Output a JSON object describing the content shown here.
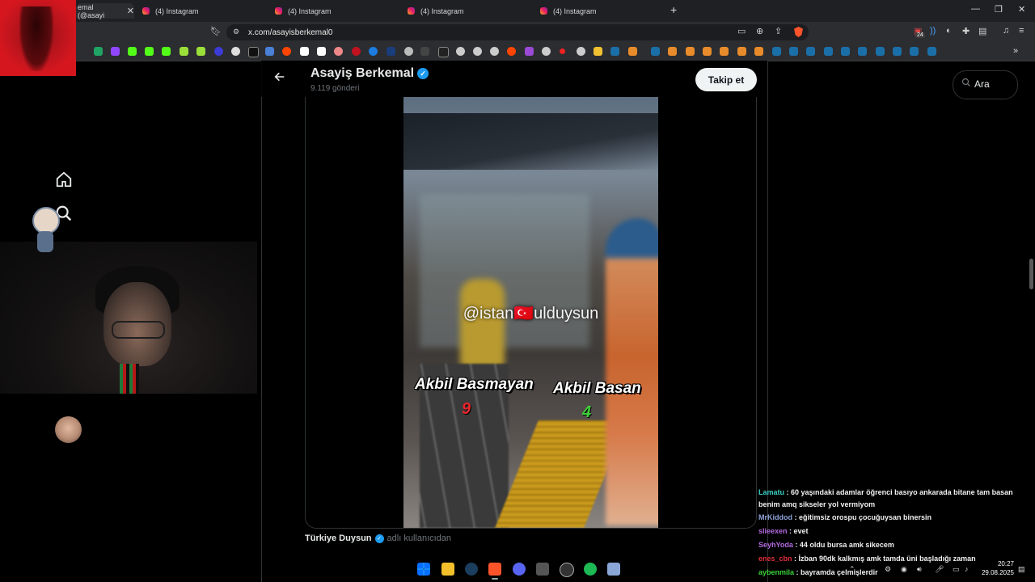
{
  "browser": {
    "tabs": [
      {
        "label": "emal (@asayi",
        "active": true
      },
      {
        "label": "(4) Instagram",
        "active": false
      },
      {
        "label": "(4) Instagram",
        "active": false
      },
      {
        "label": "(4) Instagram",
        "active": false
      },
      {
        "label": "(4) Instagram",
        "active": false
      }
    ],
    "tab_close": "✕",
    "new_tab": "+",
    "window_controls": [
      "—",
      "❐",
      "✕"
    ],
    "url": "x.com/asayisberkemal0",
    "extension_badge": "24",
    "brand_color": "#fb542b"
  },
  "profile": {
    "name": "Asayiş Berkemal",
    "post_count": "9.119 gönderi",
    "follow_label": "Takip et",
    "verified_color": "#1d9bf0"
  },
  "search": {
    "label": "Ara"
  },
  "video": {
    "watermark": "@istan🇹🇷ulduysun",
    "left_label": "Akbil Basmayan",
    "left_count": "9",
    "right_label": "Akbil Basan",
    "right_count": "4"
  },
  "post": {
    "author": "Türkiye Duysun",
    "suffix": "adlı kullanıcıdan"
  },
  "chat": [
    {
      "user": "Lamatu",
      "color": "#3ad1c4",
      "msg": "60 yaşındaki adamlar öğrenci basıyo ankarada bitane tam basan benim amq sikseler yol vermiyom"
    },
    {
      "user": "MrKiddod",
      "color": "#8ea3d8",
      "msg": "eğitimsiz orospu çocuğuysan binersin"
    },
    {
      "user": "slieexen",
      "color": "#b46be0",
      "msg": "evet"
    },
    {
      "user": "SeyhYoda",
      "color": "#b46be0",
      "msg": "44 oldu bursa amk sikecem"
    },
    {
      "user": "enes_cbn",
      "color": "#e0303a",
      "msg": "İzban      90dk kalkmış amk tamda üni başladığı zaman"
    },
    {
      "user": "aybenmila",
      "color": "#3ad13a",
      "msg": "bayramda çelmişlerdir"
    }
  ],
  "taskbar": {
    "time": "20:27",
    "date": "29.08.2025",
    "icons": [
      "windows-icon",
      "explorer-icon",
      "steam-icon",
      "brave-icon",
      "discord-icon",
      "app-icon",
      "obs-icon",
      "spotify-icon",
      "app2-icon"
    ]
  }
}
